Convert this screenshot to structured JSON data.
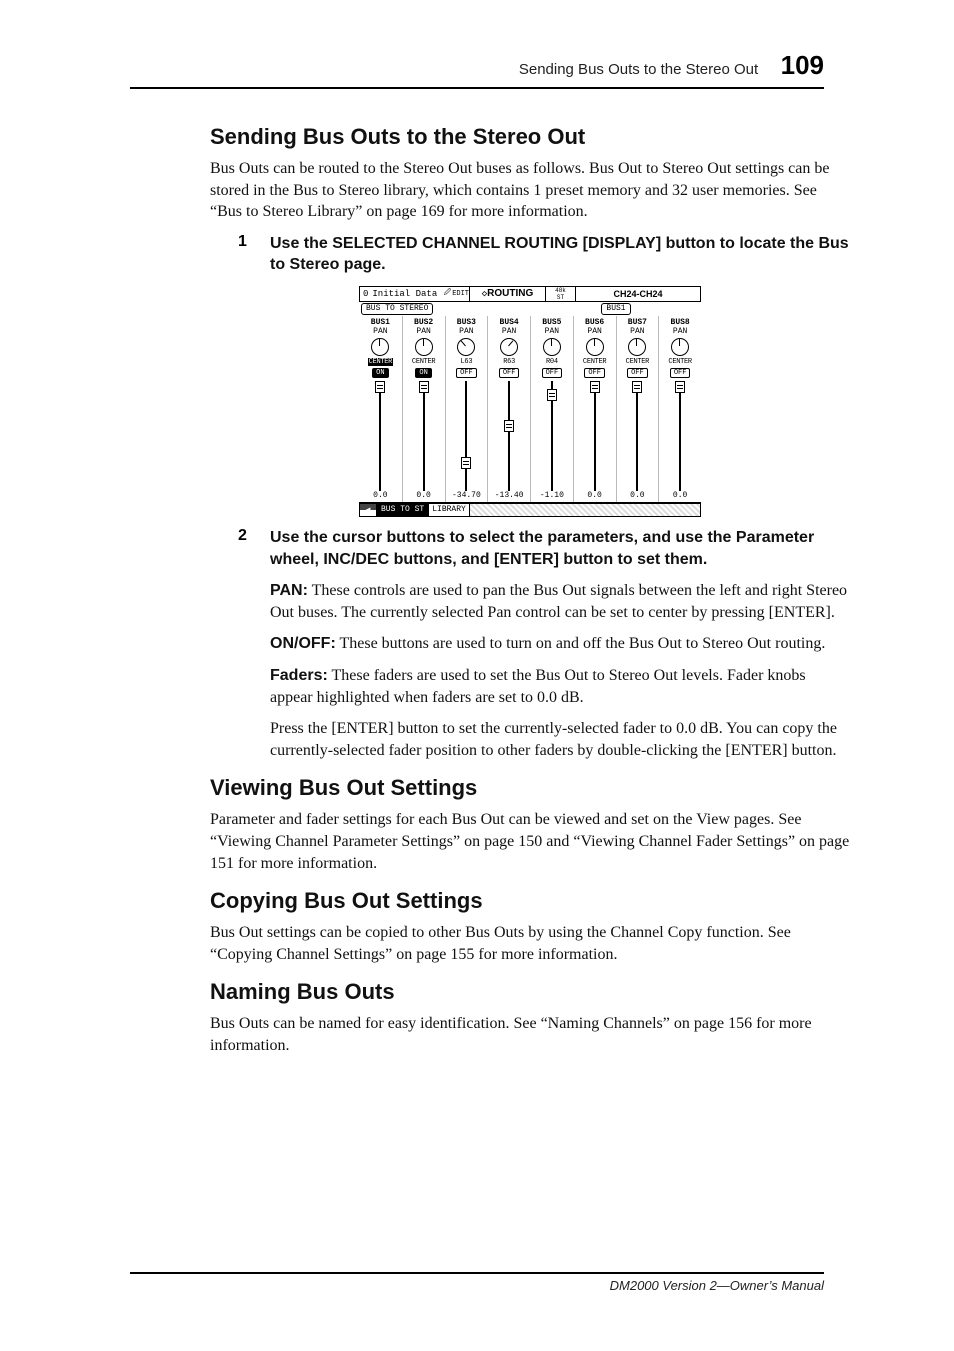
{
  "header": {
    "title": "Sending Bus Outs to the Stereo Out",
    "page": "109"
  },
  "sections": {
    "s1": {
      "title": "Sending Bus Outs to the Stereo Out",
      "intro": "Bus Outs can be routed to the Stereo Out buses as follows. Bus Out to Stereo Out settings can be stored in the Bus to Stereo library, which contains 1 preset memory and 32 user memories. See “Bus to Stereo Library” on page 169 for more information.",
      "step1_num": "1",
      "step1": "Use the SELECTED CHANNEL ROUTING [DISPLAY] button to locate the Bus to Stereo page.",
      "step2_num": "2",
      "step2": "Use the cursor buttons to select the parameters, and use the Parameter wheel, INC/DEC buttons, and [ENTER] button to set them.",
      "pan_label": "PAN:",
      "pan_text": " These controls are used to pan the Bus Out signals between the left and right Stereo Out buses. The currently selected Pan control can be set to center by pressing [ENTER].",
      "onoff_label": "ON/OFF:",
      "onoff_text": " These buttons are used to turn on and off the Bus Out to Stereo Out routing.",
      "faders_label": "Faders:",
      "faders_text": " These faders are used to set the Bus Out to Stereo Out levels. Fader knobs appear highlighted when faders are set to 0.0 dB.",
      "press_text": "Press the [ENTER] button to set the currently-selected fader to 0.0 dB. You can copy the currently-selected fader position to other faders by double-clicking the [ENTER] button."
    },
    "s2": {
      "title": "Viewing Bus Out Settings",
      "text": "Parameter and fader settings for each Bus Out can be viewed and set on the View pages. See “Viewing Channel Parameter Settings” on page 150 and “Viewing Channel Fader Settings” on page 151 for more information."
    },
    "s3": {
      "title": "Copying Bus Out Settings",
      "text": "Bus Out settings can be copied to other Bus Outs by using the Channel Copy function. See “Copying Channel Settings” on page 155 for more information."
    },
    "s4": {
      "title": "Naming Bus Outs",
      "text": "Bus Outs can be named for easy identification. See “Naming Channels” on page 156 for more information."
    }
  },
  "lcd": {
    "top_left_sceneNo": "0",
    "top_left_scene": "Initial Data",
    "top_edit": "EDIT",
    "top_routing_sym": "◇",
    "top_routing": "ROUTING",
    "top_khz": "48k",
    "top_st": "ST",
    "top_ch": "CH24-CH24",
    "tab_left": "BUS TO STEREO",
    "tab_right": "BUS1",
    "pan_label": "PAN",
    "channels": [
      {
        "name": "BUS1",
        "pan": "CENTER",
        "panSel": true,
        "knob": "c",
        "btn": "ON",
        "btnOn": true,
        "fader": 100,
        "faderPct": 0,
        "val": "0.0"
      },
      {
        "name": "BUS2",
        "pan": "CENTER",
        "panSel": false,
        "knob": "c",
        "btn": "ON",
        "btnOn": true,
        "fader": 100,
        "faderPct": 0,
        "val": "0.0"
      },
      {
        "name": "BUS3",
        "pan": "L63",
        "panSel": false,
        "knob": "neg",
        "btn": "OFF",
        "btnOn": false,
        "fader": 100,
        "faderPct": 78,
        "val": "-34.70"
      },
      {
        "name": "BUS4",
        "pan": "R63",
        "panSel": false,
        "knob": "pos",
        "btn": "OFF",
        "btnOn": false,
        "fader": 100,
        "faderPct": 40,
        "val": "-13.40"
      },
      {
        "name": "BUS5",
        "pan": "R04",
        "panSel": false,
        "knob": "c",
        "btn": "OFF",
        "btnOn": false,
        "fader": 100,
        "faderPct": 8,
        "val": "-1.10"
      },
      {
        "name": "BUS6",
        "pan": "CENTER",
        "panSel": false,
        "knob": "c",
        "btn": "OFF",
        "btnOn": false,
        "fader": 100,
        "faderPct": 0,
        "val": "0.0"
      },
      {
        "name": "BUS7",
        "pan": "CENTER",
        "panSel": false,
        "knob": "c",
        "btn": "OFF",
        "btnOn": false,
        "fader": 100,
        "faderPct": 0,
        "val": "0.0"
      },
      {
        "name": "BUS8",
        "pan": "CENTER",
        "panSel": false,
        "knob": "c",
        "btn": "OFF",
        "btnOn": false,
        "fader": 100,
        "faderPct": 0,
        "val": "0.0"
      }
    ],
    "bottom_arrow": "◀",
    "bottom_tab1": "BUS TO ST",
    "bottom_tab2": "LIBRARY"
  },
  "footer": "DM2000 Version 2—Owner’s Manual"
}
